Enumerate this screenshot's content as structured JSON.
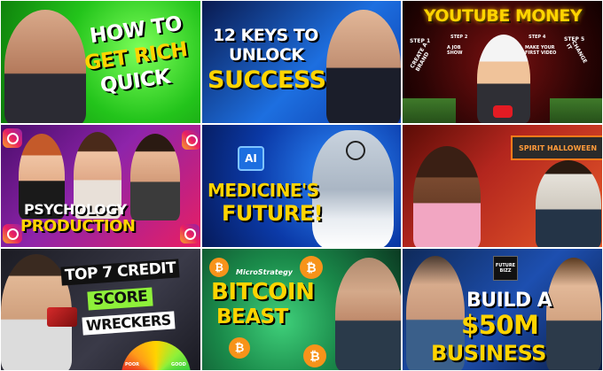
{
  "tiles": [
    {
      "id": "how-to-get-rich",
      "lines": [
        "HOW TO",
        "GET RICH",
        "QUICK"
      ]
    },
    {
      "id": "12-keys",
      "lines": [
        "12 KEYS TO",
        "UNLOCK",
        "SUCCESS"
      ]
    },
    {
      "id": "youtube-money",
      "title": "YOUTUBE MONEY",
      "steps": [
        "STEP 1",
        "STEP 2",
        "STEP 3",
        "STEP 4",
        "STEP 5"
      ],
      "step_texts": [
        "CREATE A BRAND",
        "A JOB SHOW",
        "MAKE YOUR FIRST VIDEO",
        "CHANGE IT"
      ]
    },
    {
      "id": "psychology",
      "lines": [
        "PSYCHOLOGY",
        "PRODUCTION"
      ]
    },
    {
      "id": "ai-medicine",
      "badge": "AI",
      "lines": [
        "MEDICINE'S",
        "FUTURE!"
      ]
    },
    {
      "id": "spirit-halloween",
      "sign": "SPIRIT HALLOWEEN"
    },
    {
      "id": "credit",
      "lines": [
        "TOP 7 CREDIT",
        "SCORE",
        "WRECKERS"
      ],
      "gauge": [
        "POOR",
        "GOOD"
      ]
    },
    {
      "id": "bitcoin",
      "brand": "MicroStrategy",
      "lines": [
        "BITCOIN",
        "BEAST"
      ]
    },
    {
      "id": "business",
      "logo": [
        "FUTURE",
        "BIZZ"
      ],
      "lines": [
        "BUILD A",
        "$50M",
        "BUSINESS"
      ]
    }
  ],
  "colors": {
    "green": "#27c93f",
    "yellow": "#ffd400",
    "red": "#e31b23",
    "blue": "#1d6fe0"
  }
}
